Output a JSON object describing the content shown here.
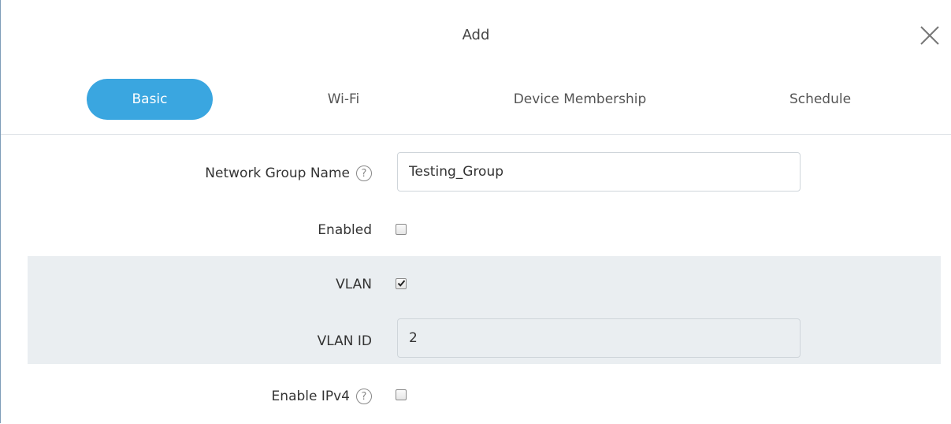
{
  "dialog": {
    "title": "Add"
  },
  "tabs": [
    {
      "label": "Basic",
      "active": true
    },
    {
      "label": "Wi-Fi",
      "active": false
    },
    {
      "label": "Device Membership",
      "active": false
    },
    {
      "label": "Schedule",
      "active": false
    }
  ],
  "form": {
    "network_group_name": {
      "label": "Network Group Name",
      "value": "Testing_Group",
      "help": "?"
    },
    "enabled": {
      "label": "Enabled",
      "checked": false
    },
    "vlan": {
      "label": "VLAN",
      "checked": true
    },
    "vlan_id": {
      "label": "VLAN ID",
      "value": "2"
    },
    "enable_ipv4": {
      "label": "Enable IPv4",
      "checked": false,
      "help": "?"
    }
  },
  "colors": {
    "accent": "#3aa6e0",
    "shaded_row": "#eaeef1"
  },
  "icons": {
    "close": "close-icon",
    "help": "help-icon",
    "checkmark": "checkmark-icon"
  }
}
